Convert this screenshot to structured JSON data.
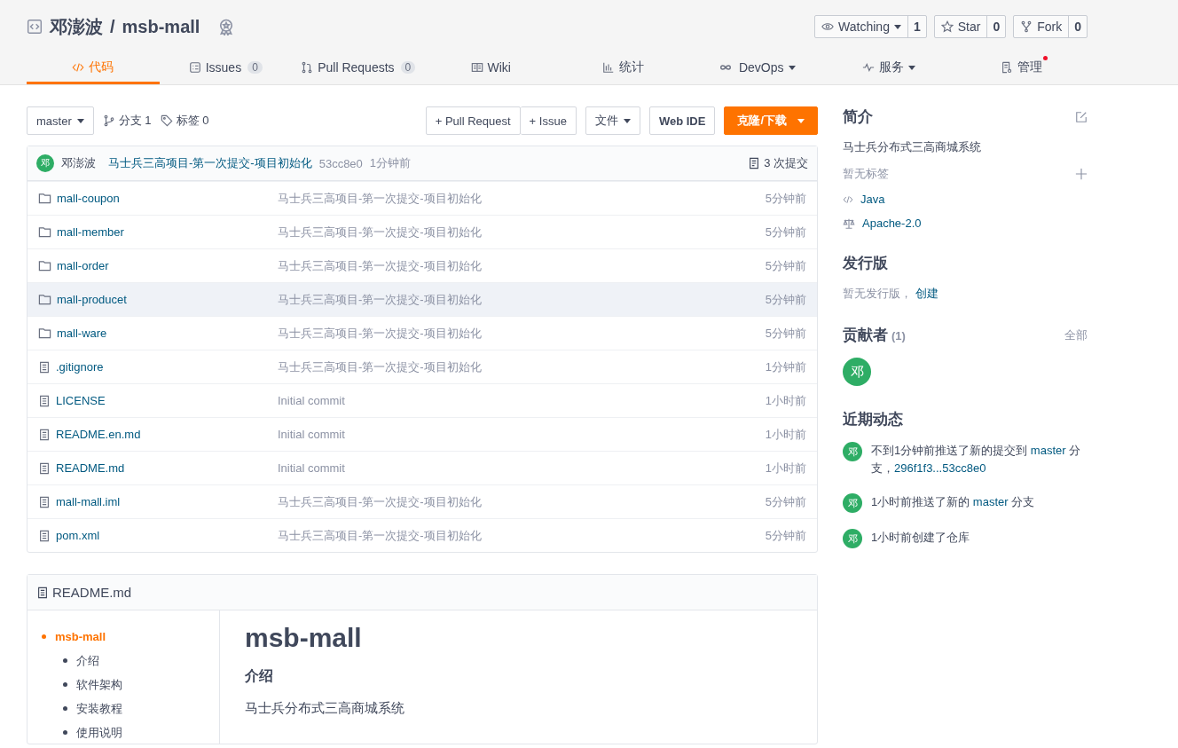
{
  "repo": {
    "owner": "邓澎波",
    "separator": "/",
    "name": "msb-mall"
  },
  "repo_actions": [
    {
      "kind": "watch",
      "label": "Watching",
      "count": "1"
    },
    {
      "kind": "star",
      "label": "Star",
      "count": "0"
    },
    {
      "kind": "fork",
      "label": "Fork",
      "count": "0"
    }
  ],
  "tabs": [
    {
      "label": "代码",
      "selected": true
    },
    {
      "label": "Issues",
      "count": "0",
      "selected": false
    },
    {
      "label": "Pull Requests",
      "count": "0",
      "selected": false
    },
    {
      "label": "Wiki",
      "selected": false
    },
    {
      "label": "统计",
      "selected": false
    },
    {
      "label": "DevOps",
      "dropdown": true,
      "selected": false
    },
    {
      "label": "服务",
      "dropdown": true,
      "selected": false
    },
    {
      "label": "管理",
      "notify": true,
      "selected": false
    }
  ],
  "toolbar": {
    "branch": "master",
    "branches": "分支 1",
    "tags": "标签 0",
    "pull_request": "+ Pull Request",
    "issue": "+ Issue",
    "file": "文件",
    "web_ide": "Web IDE",
    "clone": "克隆/下载"
  },
  "last_commit": {
    "avatar": "邓",
    "author": "邓澎波",
    "message": "马士兵三高项目-第一次提交-项目初始化",
    "hash": "53cc8e0",
    "time": "1分钟前",
    "commits": "3 次提交"
  },
  "files": [
    {
      "kind": "folder",
      "name": "mall-coupon",
      "message": "马士兵三高项目-第一次提交-项目初始化",
      "time": "5分钟前",
      "selected": false
    },
    {
      "kind": "folder",
      "name": "mall-member",
      "message": "马士兵三高项目-第一次提交-项目初始化",
      "time": "5分钟前",
      "selected": false
    },
    {
      "kind": "folder",
      "name": "mall-order",
      "message": "马士兵三高项目-第一次提交-项目初始化",
      "time": "5分钟前",
      "selected": false
    },
    {
      "kind": "folder",
      "name": "mall-producet",
      "message": "马士兵三高项目-第一次提交-项目初始化",
      "time": "5分钟前",
      "selected": true
    },
    {
      "kind": "folder",
      "name": "mall-ware",
      "message": "马士兵三高项目-第一次提交-项目初始化",
      "time": "5分钟前",
      "selected": false
    },
    {
      "kind": "file",
      "name": ".gitignore",
      "message": "马士兵三高项目-第一次提交-项目初始化",
      "time": "1分钟前",
      "selected": false
    },
    {
      "kind": "file",
      "name": "LICENSE",
      "message": "Initial commit",
      "time": "1小时前",
      "selected": false
    },
    {
      "kind": "file",
      "name": "README.en.md",
      "message": "Initial commit",
      "time": "1小时前",
      "selected": false
    },
    {
      "kind": "file",
      "name": "README.md",
      "message": "Initial commit",
      "time": "1小时前",
      "selected": false
    },
    {
      "kind": "file",
      "name": "mall-mall.iml",
      "message": "马士兵三高项目-第一次提交-项目初始化",
      "time": "5分钟前",
      "selected": false
    },
    {
      "kind": "file",
      "name": "pom.xml",
      "message": "马士兵三高项目-第一次提交-项目初始化",
      "time": "5分钟前",
      "selected": false
    }
  ],
  "readme": {
    "filename": "README.md",
    "toc": [
      {
        "label": "msb-mall",
        "selected": true,
        "children": [
          {
            "label": "介绍",
            "selected": false
          },
          {
            "label": "软件架构",
            "selected": false
          },
          {
            "label": "安装教程",
            "selected": false
          },
          {
            "label": "使用说明",
            "selected": false
          }
        ]
      }
    ],
    "title": "msb-mall",
    "heading": "介绍",
    "body": "马士兵分布式三高商城系统"
  },
  "sidebar": {
    "intro_title": "简介",
    "description": "马士兵分布式三高商城系统",
    "no_tags": "暂无标签",
    "language": "Java",
    "license": "Apache-2.0",
    "releases_title": "发行版",
    "no_releases": "暂无发行版，",
    "create": "创建",
    "contributors_title": "贡献者",
    "contributors_count": "(1)",
    "all": "全部",
    "contributors": [
      {
        "avatar": "邓"
      }
    ],
    "activity_title": "近期动态",
    "activity": [
      {
        "avatar": "邓",
        "parts": [
          {
            "text": "不到1分钟前推送了新的提交到 ",
            "kind": "text"
          },
          {
            "text": "master",
            "kind": "link"
          },
          {
            "text": " 分支，",
            "kind": "text"
          },
          {
            "text": "296f1f3...53cc8e0",
            "kind": "link"
          }
        ]
      },
      {
        "avatar": "邓",
        "parts": [
          {
            "text": "1小时前推送了新的 ",
            "kind": "text"
          },
          {
            "text": "master",
            "kind": "link"
          },
          {
            "text": " 分支",
            "kind": "text"
          }
        ]
      },
      {
        "avatar": "邓",
        "parts": [
          {
            "text": "1小时前创建了仓库",
            "kind": "text"
          }
        ]
      }
    ]
  }
}
